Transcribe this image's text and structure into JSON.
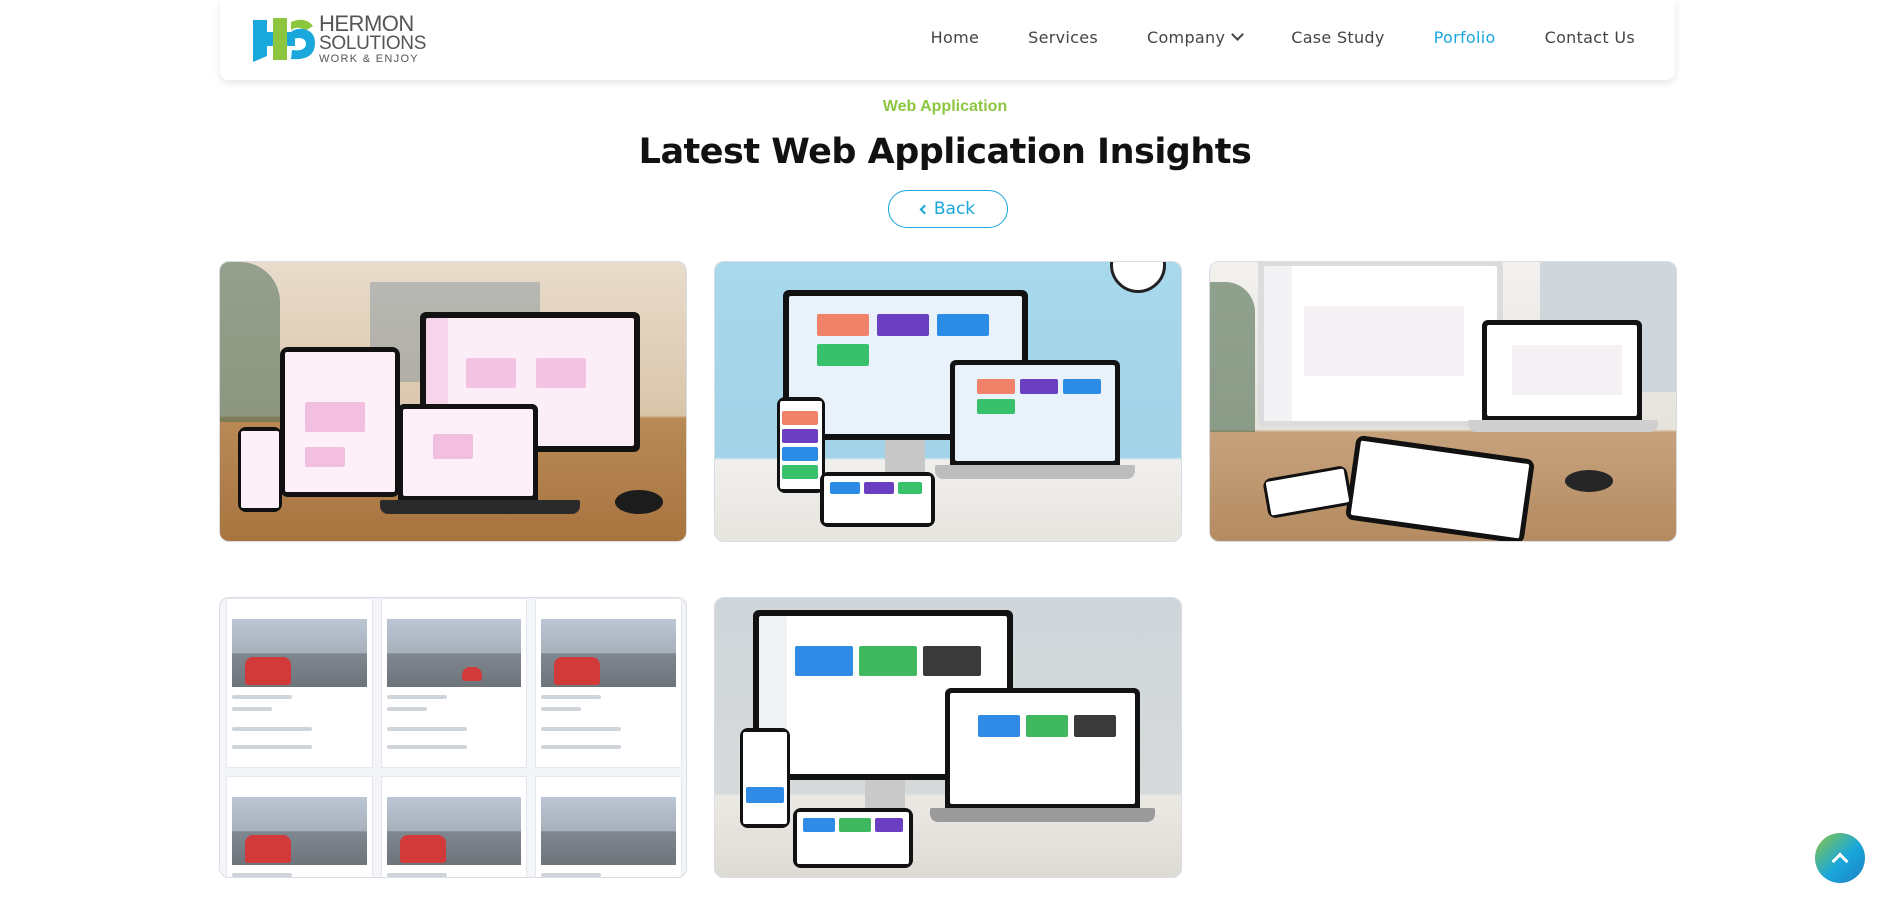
{
  "brand": {
    "name_line1": "HERMON",
    "name_line2": "SOLUTIONS",
    "tagline": "WORK & ENJOY",
    "colors": {
      "green": "#8cc63f",
      "blue": "#1aa7dc"
    }
  },
  "nav": {
    "items": [
      {
        "label": "Home",
        "active": false
      },
      {
        "label": "Services",
        "active": false
      },
      {
        "label": "Company",
        "active": false,
        "has_dropdown": true
      },
      {
        "label": "Case Study",
        "active": false
      },
      {
        "label": "Porfolio",
        "active": true
      },
      {
        "label": "Contact Us",
        "active": false
      }
    ]
  },
  "section": {
    "eyebrow": "Web Application",
    "title": "Latest Web Application Insights",
    "back_label": "Back"
  },
  "portfolio": {
    "items": [
      {
        "icon": "portfolio-image"
      },
      {
        "icon": "portfolio-image"
      },
      {
        "icon": "portfolio-image"
      },
      {
        "icon": "portfolio-image"
      },
      {
        "icon": "portfolio-image"
      }
    ]
  },
  "scroll_top": {
    "icon": "arrow-up-icon"
  }
}
